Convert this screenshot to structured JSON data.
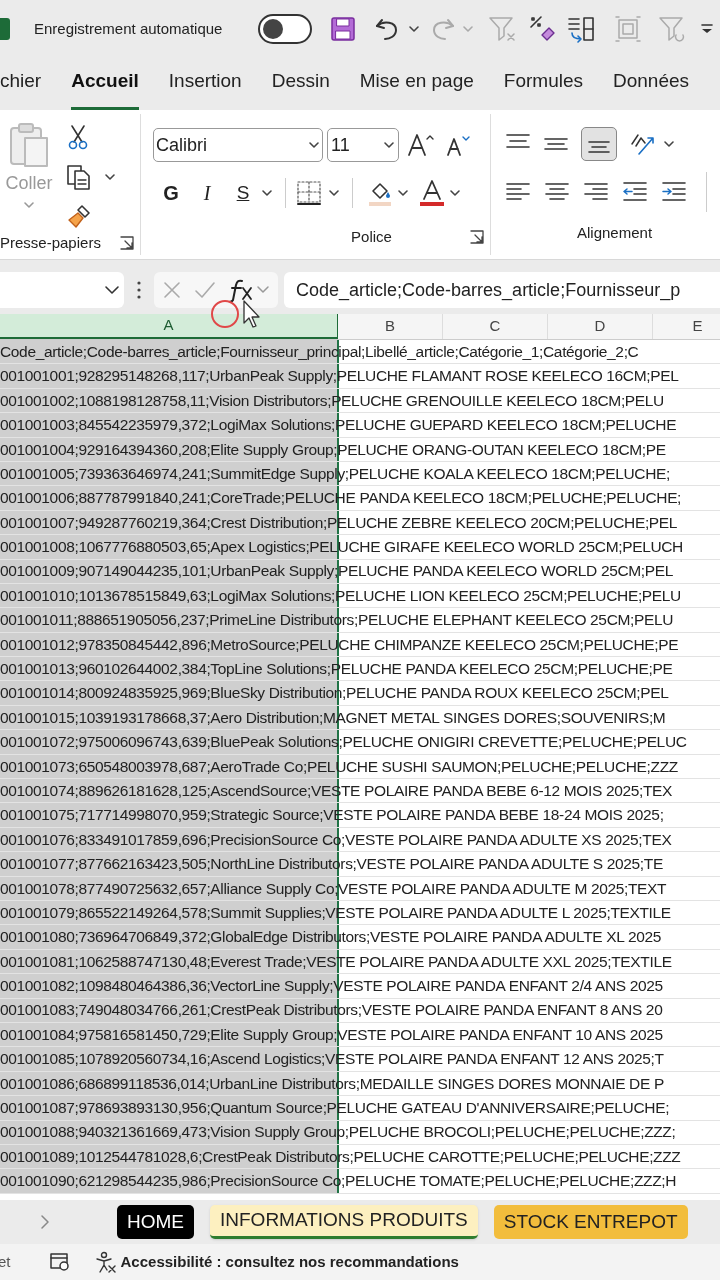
{
  "title_bar": {
    "autosave_label": "Enregistrement automatique",
    "autosave_on": false
  },
  "ribbon_tabs": [
    {
      "label": "chier",
      "selected": false
    },
    {
      "label": "Accueil",
      "selected": true
    },
    {
      "label": "Insertion",
      "selected": false
    },
    {
      "label": "Dessin",
      "selected": false
    },
    {
      "label": "Mise en page",
      "selected": false
    },
    {
      "label": "Formules",
      "selected": false
    },
    {
      "label": "Données",
      "selected": false
    }
  ],
  "ribbon": {
    "paste_label": "Coller",
    "clipboard_group": "Presse-papiers",
    "font_name": "Calibri",
    "font_size": "11",
    "bold_label": "G",
    "italic_label": "I",
    "underline_label": "S",
    "font_group": "Police",
    "alignment_group": "Alignement",
    "bottom_align_selected": true
  },
  "formula_bar": {
    "value": "Code_article;Code-barres_article;Fournisseur_p"
  },
  "columns": [
    {
      "label": "A",
      "selected": true
    },
    {
      "label": "B",
      "selected": false
    },
    {
      "label": "C",
      "selected": false
    },
    {
      "label": "D",
      "selected": false
    },
    {
      "label": "E",
      "selected": false
    }
  ],
  "rows": [
    "Code_article;Code-barres_article;Fournisseur_principal;Libellé_article;Catégorie_1;Catégorie_2;C",
    "001001001;928295148268,117;UrbanPeak Supply;PELUCHE FLAMANT ROSE KEELECO 16CM;PEL",
    "001001002;1088198128758,11;Vision Distributors;PELUCHE GRENOUILLE KEELECO 18CM;PELU",
    "001001003;845542235979,372;LogiMax Solutions;PELUCHE GUEPARD KEELECO 18CM;PELUCHE",
    "001001004;929164394360,208;Elite Supply Group;PELUCHE ORANG-OUTAN KEELECO 18CM;PE",
    "001001005;739363646974,241;SummitEdge Supply;PELUCHE KOALA KEELECO 18CM;PELUCHE;",
    "001001006;887787991840,241;CoreTrade;PELUCHE PANDA KEELECO 18CM;PELUCHE;PELUCHE;",
    "001001007;949287760219,364;Crest Distribution;PELUCHE ZEBRE KEELECO 20CM;PELUCHE;PEL",
    "001001008;1067776880503,65;Apex Logistics;PELUCHE GIRAFE KEELECO WORLD 25CM;PELUCH",
    "001001009;907149044235,101;UrbanPeak Supply;PELUCHE PANDA KEELECO WORLD 25CM;PEL",
    "001001010;1013678515849,63;LogiMax Solutions;PELUCHE LION KEELECO 25CM;PELUCHE;PELU",
    "001001011;888651905056,237;PrimeLine Distributors;PELUCHE ELEPHANT KEELECO 25CM;PELU",
    "001001012;978350845442,896;MetroSource;PELUCHE CHIMPANZE KEELECO 25CM;PELUCHE;PE",
    "001001013;960102644002,384;TopLine Solutions;PELUCHE PANDA KEELECO 25CM;PELUCHE;PE",
    "001001014;800924835925,969;BlueSky Distribution;PELUCHE PANDA ROUX KEELECO 25CM;PEL",
    "001001015;1039193178668,37;Aero Distribution;MAGNET METAL SINGES DORES;SOUVENIRS;M",
    "001001072;975006096743,639;BluePeak Solutions;PELUCHE ONIGIRI CREVETTE;PELUCHE;PELUC",
    "001001073;650548003978,687;AeroTrade Co;PELUCHE SUSHI SAUMON;PELUCHE;PELUCHE;ZZZ",
    "001001074;889626181628,125;AscendSource;VESTE POLAIRE PANDA BEBE 6-12 MOIS 2025;TEX",
    "001001075;717714998070,959;Strategic Source;VESTE POLAIRE PANDA BEBE 18-24 MOIS 2025;",
    "001001076;833491017859,696;PrecisionSource Co;VESTE POLAIRE PANDA ADULTE XS 2025;TEX",
    "001001077;877662163423,505;NorthLine Distributors;VESTE POLAIRE PANDA ADULTE S 2025;TE",
    "001001078;877490725632,657;Alliance Supply Co;VESTE POLAIRE PANDA ADULTE M 2025;TEXT",
    "001001079;865522149264,578;Summit Supplies;VESTE POLAIRE PANDA ADULTE L 2025;TEXTILE",
    "001001080;736964706849,372;GlobalEdge Distributors;VESTE POLAIRE PANDA ADULTE XL 2025",
    "001001081;1062588747130,48;Everest Trade;VESTE POLAIRE PANDA ADULTE XXL 2025;TEXTILE",
    "001001082;1098480464386,36;VectorLine Supply;VESTE POLAIRE PANDA ENFANT 2/4 ANS 2025",
    "001001083;749048034766,261;CrestPeak Distributors;VESTE POLAIRE PANDA ENFANT 8 ANS 20",
    "001001084;975816581450,729;Elite Supply Group;VESTE POLAIRE PANDA ENFANT 10 ANS 2025",
    "001001085;1078920560734,16;Ascend Logistics;VESTE POLAIRE PANDA ENFANT 12 ANS 2025;T",
    "001001086;686899118536,014;UrbanLine Distributors;MEDAILLE SINGES DORES MONNAIE DE P",
    "001001087;978693893130,956;Quantum Source;PELUCHE GATEAU D'ANNIVERSAIRE;PELUCHE;",
    "001001088;940321361669,473;Vision Supply Group;PELUCHE BROCOLI;PELUCHE;PELUCHE;ZZZ;",
    "001001089;1012544781028,6;CrestPeak Distributors;PELUCHE CAROTTE;PELUCHE;PELUCHE;ZZZ",
    "001001090;621298544235,986;PrecisionSource Co;PELUCHE TOMATE;PELUCHE;PELUCHE;ZZZ;H"
  ],
  "sheet_tabs": [
    {
      "label": "HOME",
      "selected": false,
      "color": "#000000"
    },
    {
      "label": "INFORMATIONS PRODUITS",
      "selected": true,
      "color": "#fdf0c0"
    },
    {
      "label": "STOCK ENTREPOT",
      "selected": false,
      "color": "#f2bd3c"
    }
  ],
  "status_bar": {
    "left_text": "et",
    "accessibility": "Accessibilité : consultez nos recommandations"
  }
}
